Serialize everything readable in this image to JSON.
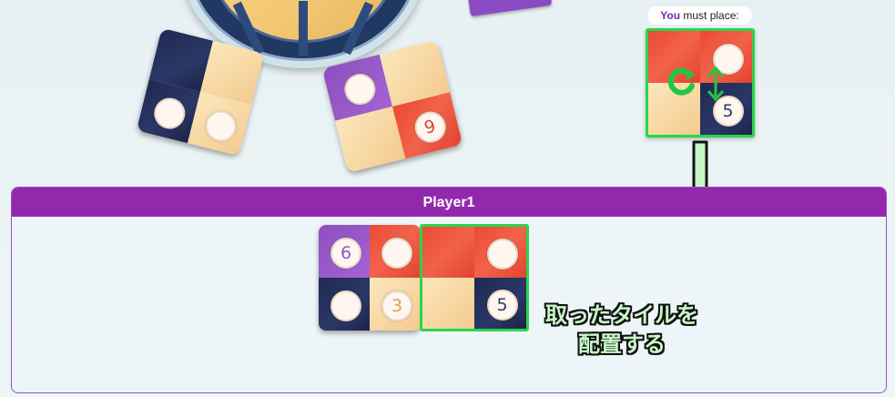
{
  "prompt": {
    "you": "You",
    "rest": " must place:"
  },
  "player_panel": {
    "title": "Player1"
  },
  "instruction": {
    "line1": "取ったタイルを",
    "line2": "配置する"
  },
  "selected_tile": {
    "number": "5"
  },
  "table_tiles": [
    {
      "id": "tile-a",
      "numbers": []
    },
    {
      "id": "tile-b",
      "numbers": [
        "9"
      ]
    }
  ],
  "player_tiles": {
    "numbers": [
      "6",
      "3",
      "5"
    ]
  },
  "colors": {
    "accent_purple": "#9229ad",
    "highlight_green": "#28d64a",
    "arrow_fill": "#c7f7c7"
  },
  "icons": [
    "rotate-icon",
    "flip-icon",
    "place-arrow-icon"
  ]
}
